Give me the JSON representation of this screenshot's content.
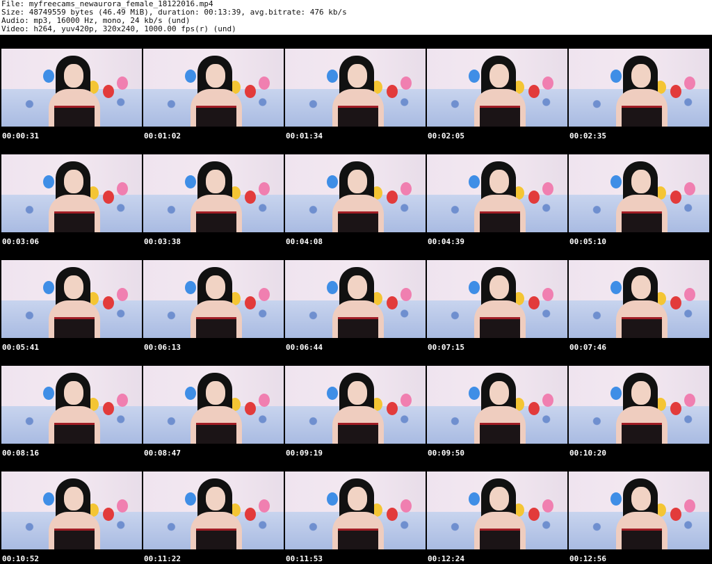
{
  "header": {
    "file": "File: myfreecams_newaurora_female_18122016.mp4",
    "size": "Size: 48749559 bytes (46.49 MiB), duration: 00:13:39, avg.bitrate: 476 kb/s",
    "audio": "Audio: mp3, 16000 Hz, mono, 24 kb/s (und)",
    "video": "Video: h264, yuv420p, 320x240, 1000.00 fps(r) (und)"
  },
  "thumbnails": [
    {
      "time": "00:00:31"
    },
    {
      "time": "00:01:02"
    },
    {
      "time": "00:01:34"
    },
    {
      "time": "00:02:05"
    },
    {
      "time": "00:02:35"
    },
    {
      "time": "00:03:06"
    },
    {
      "time": "00:03:38"
    },
    {
      "time": "00:04:08"
    },
    {
      "time": "00:04:39"
    },
    {
      "time": "00:05:10"
    },
    {
      "time": "00:05:41"
    },
    {
      "time": "00:06:13"
    },
    {
      "time": "00:06:44"
    },
    {
      "time": "00:07:15"
    },
    {
      "time": "00:07:46"
    },
    {
      "time": "00:08:16"
    },
    {
      "time": "00:08:47"
    },
    {
      "time": "00:09:19"
    },
    {
      "time": "00:09:50"
    },
    {
      "time": "00:10:20"
    },
    {
      "time": "00:10:52"
    },
    {
      "time": "00:11:22"
    },
    {
      "time": "00:11:53"
    },
    {
      "time": "00:12:24"
    },
    {
      "time": "00:12:56"
    }
  ]
}
